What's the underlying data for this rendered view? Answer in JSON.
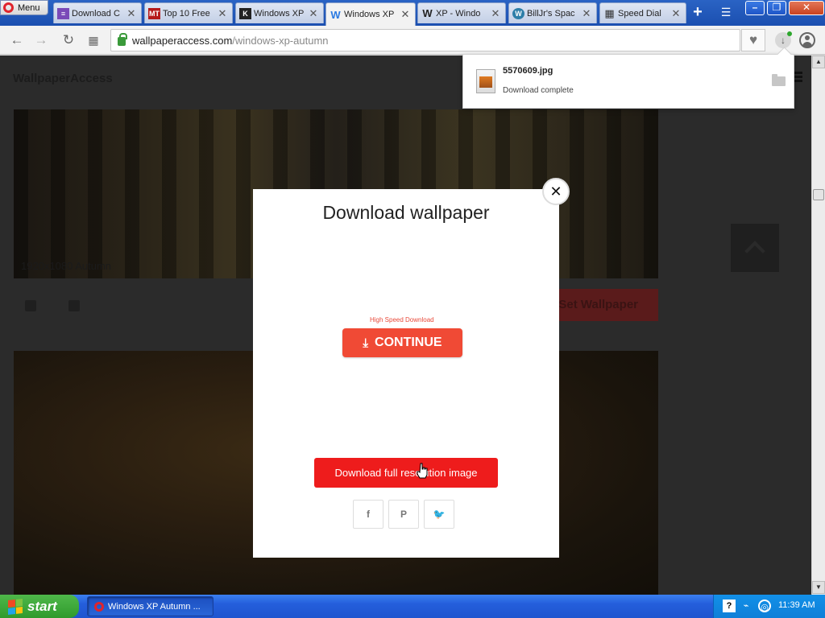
{
  "browser": {
    "menu_label": "Menu",
    "tabs": [
      {
        "label": "Download C",
        "icon": "page-icon"
      },
      {
        "label": "Top 10 Free",
        "icon": "mt-icon"
      },
      {
        "label": "Windows XP",
        "icon": "k-icon"
      },
      {
        "label": "Windows XP",
        "icon": "wallpaperaccess-icon"
      },
      {
        "label": "XP - Windo",
        "icon": "wikipedia-icon"
      },
      {
        "label": "BillJr's Spac",
        "icon": "wordpress-icon"
      },
      {
        "label": "Speed Dial",
        "icon": "speed-dial-icon"
      }
    ],
    "url_host": "wallpaperaccess.com",
    "url_path": "/windows-xp-autumn"
  },
  "download_popup": {
    "filename": "5570609.jpg",
    "status": "Download complete"
  },
  "site": {
    "logo": "WallpaperAccess",
    "resolution_label": "1920x1080 Autumn",
    "set_wallpaper_label": "Set Wallpaper"
  },
  "modal": {
    "title": "Download wallpaper",
    "high_speed_label": "High Speed Download",
    "continue_label": "CONTINUE",
    "full_resolution_label": "Download full resolution image"
  },
  "taskbar": {
    "start_label": "start",
    "task_label": "Windows XP Autumn ...",
    "clock": "11:39 AM"
  },
  "colors": {
    "continue_button": "#f04a35",
    "full_resolution_button": "#ee1c1c",
    "taskbar": "#245edb",
    "start_button": "#2f9a2c"
  }
}
